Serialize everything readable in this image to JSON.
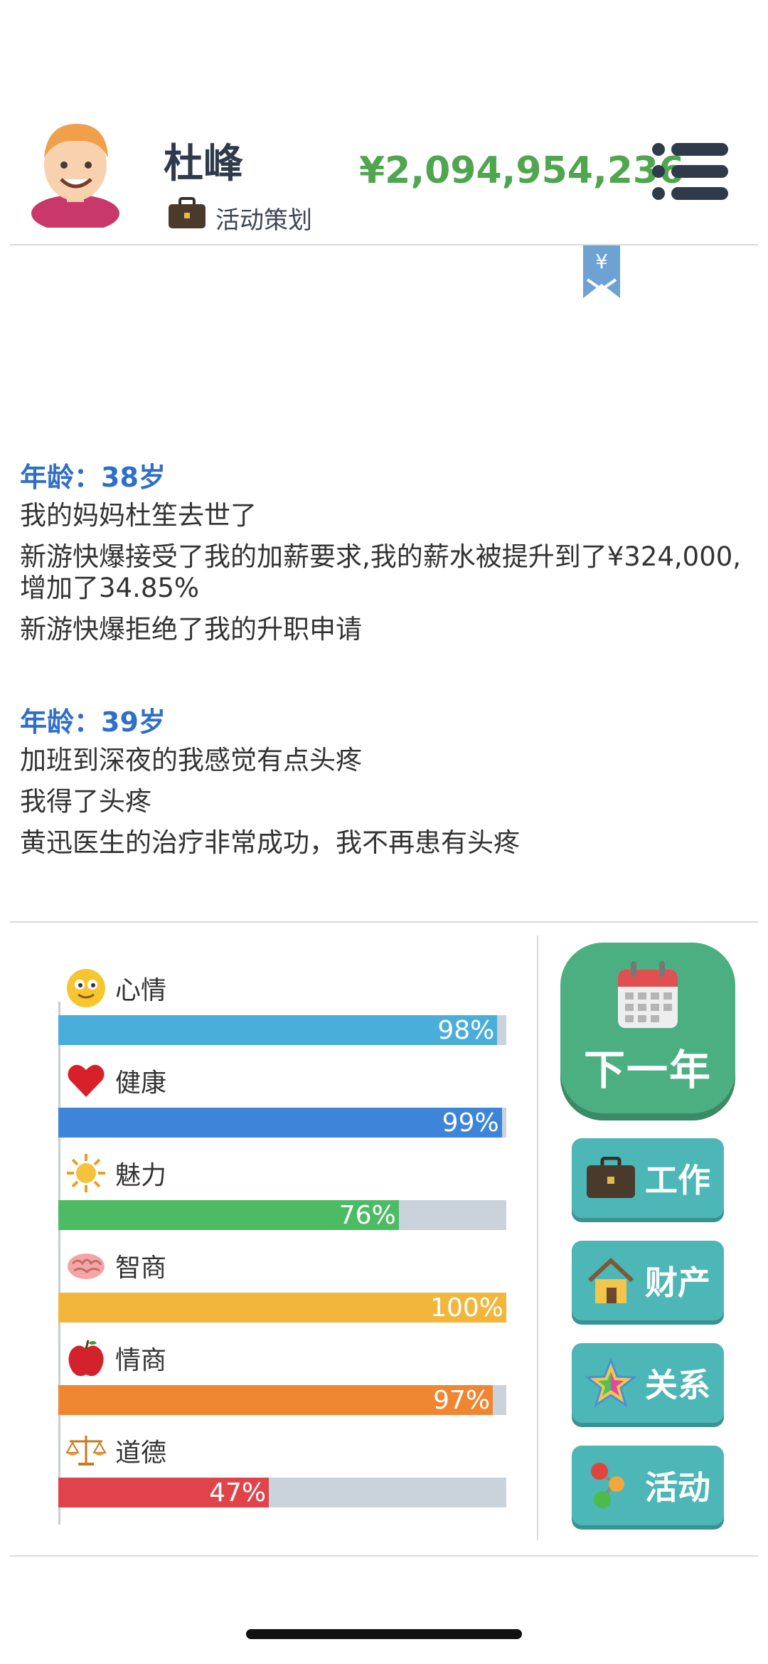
{
  "header": {
    "name": "杜峰",
    "job": "活动策划",
    "money": "¥2,094,954,236",
    "bookmark_symbol": "¥",
    "money_color": "#4fa64f"
  },
  "log": [
    {
      "age": "年龄：38岁",
      "lines": [
        "我的妈妈杜笙去世了",
        "新游快爆接受了我的加薪要求,我的薪水被提升到了¥324,000,增加了34.85%",
        "新游快爆拒绝了我的升职申请"
      ]
    },
    {
      "age": "年龄：39岁",
      "lines": [
        "加班到深夜的我感觉有点头疼",
        "我得了头疼",
        "黄迅医生的治疗非常成功，我不再患有头疼"
      ]
    }
  ],
  "stats": [
    {
      "label": "心情",
      "value": 98,
      "pct": "98%",
      "color": "#4aaedb",
      "icon": "smiley-icon"
    },
    {
      "label": "健康",
      "value": 99,
      "pct": "99%",
      "color": "#3d85d8",
      "icon": "heart-icon"
    },
    {
      "label": "魅力",
      "value": 76,
      "pct": "76%",
      "color": "#4cbb63",
      "icon": "sun-icon"
    },
    {
      "label": "智商",
      "value": 100,
      "pct": "100%",
      "color": "#f3b63d",
      "icon": "brain-icon"
    },
    {
      "label": "情商",
      "value": 97,
      "pct": "97%",
      "color": "#ef8631",
      "icon": "apple-icon"
    },
    {
      "label": "道德",
      "value": 47,
      "pct": "47%",
      "color": "#e0444a",
      "icon": "scales-icon"
    }
  ],
  "buttons": {
    "next_year": "下一年",
    "job": "工作",
    "assets": "财产",
    "relations": "关系",
    "activity": "活动"
  }
}
